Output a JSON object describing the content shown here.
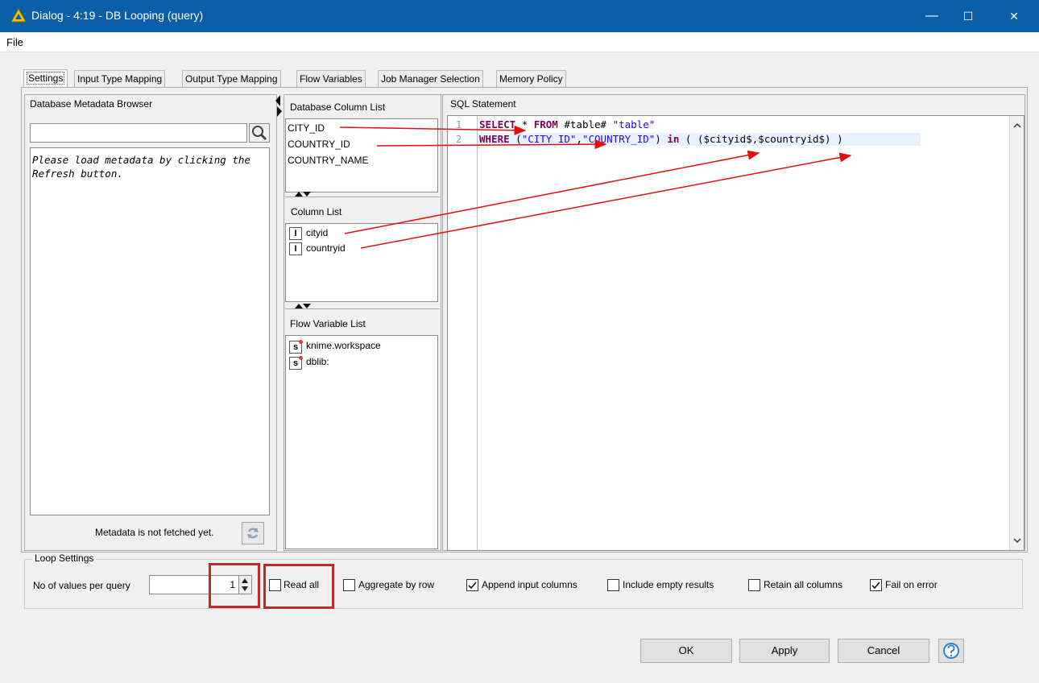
{
  "window": {
    "title": "Dialog - 4:19 - DB Looping (query)",
    "minimize_glyph": "—",
    "maximize_glyph": "☐",
    "close_glyph": "✕"
  },
  "menu": {
    "file": "File"
  },
  "tabs": [
    {
      "label": "Settings"
    },
    {
      "label": "Input Type Mapping"
    },
    {
      "label": "Output Type Mapping"
    },
    {
      "label": "Flow Variables"
    },
    {
      "label": "Job Manager Selection"
    },
    {
      "label": "Memory Policy"
    }
  ],
  "metadata_browser": {
    "title": "Database Metadata Browser",
    "search_value": "",
    "message": "Please load metadata by clicking the Refresh button.",
    "status": "Metadata is not fetched yet."
  },
  "db_column_list": {
    "title": "Database Column List",
    "items": [
      "CITY_ID",
      "COUNTRY_ID",
      "COUNTRY_NAME"
    ]
  },
  "column_list": {
    "title": "Column List",
    "items": [
      {
        "type_icon": "I",
        "name": "cityid"
      },
      {
        "type_icon": "I",
        "name": "countryid"
      }
    ]
  },
  "flow_variable_list": {
    "title": "Flow Variable List",
    "items": [
      {
        "type_icon": "s",
        "name": "knime.workspace"
      },
      {
        "type_icon": "s",
        "name": "dblib:"
      }
    ]
  },
  "sql": {
    "title": "SQL Statement",
    "line_numbers": [
      "1",
      "2"
    ],
    "line1": {
      "kw1": "SELECT",
      "t1": " * ",
      "kw2": "FROM",
      "t2": " #table# ",
      "s1": "\"table\""
    },
    "line2": {
      "kw1": "WHERE",
      "t1": " (",
      "s1": "\"CITY_ID\"",
      "t2": ",",
      "s2": "\"COUNTRY_ID\"",
      "t3": ") ",
      "kw2": "in",
      "t4": " ( ($cityid$,$countryid$) )"
    }
  },
  "loop_settings": {
    "title": "Loop Settings",
    "values_label": "No of values per query",
    "values_value": "1",
    "checkboxes": [
      {
        "label": "Read all",
        "checked": false
      },
      {
        "label": "Aggregate by row",
        "checked": false
      },
      {
        "label": "Append input columns",
        "checked": true
      },
      {
        "label": "Include empty results",
        "checked": false
      },
      {
        "label": "Retain all columns",
        "checked": false
      },
      {
        "label": "Fail on error",
        "checked": true
      }
    ]
  },
  "buttons": {
    "ok": "OK",
    "apply": "Apply",
    "cancel": "Cancel"
  },
  "colors": {
    "titlebar": "#0b5fa8",
    "highlight": "#c0282a",
    "annotation_arrow": "#e01010"
  }
}
